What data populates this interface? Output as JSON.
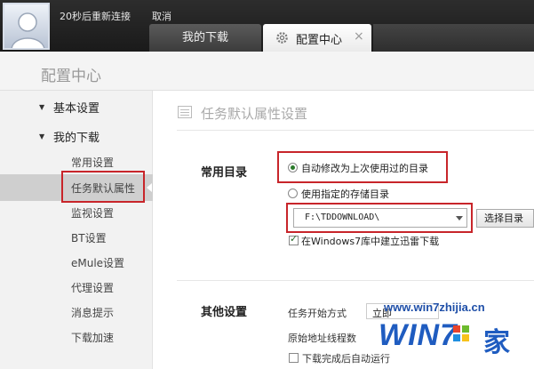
{
  "header": {
    "reconnect_text": "20秒后重新连接",
    "cancel_label": "取消",
    "tabs": [
      {
        "label": "我的下载"
      },
      {
        "label": "配置中心",
        "close": "×"
      }
    ]
  },
  "config_title": "配置中心",
  "sidebar": {
    "groups": [
      {
        "label": "基本设置",
        "arrow": "▼"
      },
      {
        "label": "我的下载",
        "arrow": "▼"
      }
    ],
    "items": [
      {
        "label": "常用设置"
      },
      {
        "label": "任务默认属性"
      },
      {
        "label": "监视设置"
      },
      {
        "label": "BT设置"
      },
      {
        "label": "eMule设置"
      },
      {
        "label": "代理设置"
      },
      {
        "label": "消息提示"
      },
      {
        "label": "下载加速"
      }
    ],
    "selected_index": 1
  },
  "main": {
    "section_title": "任务默认属性设置",
    "common_dir": {
      "label": "常用目录",
      "option_auto": "自动修改为上次使用过的目录",
      "option_specified": "使用指定的存储目录",
      "selected": "auto",
      "path_value": "F:\\TDDOWNLOAD\\",
      "choose_button": "选择目录",
      "win7_library_label": "在Windows7库中建立迅雷下载",
      "win7_library_checked": true
    },
    "other": {
      "label": "其他设置",
      "task_start_label": "任务开始方式",
      "task_start_value": "立即",
      "threads_label": "原始地址线程数",
      "run_after_label": "下载完成后自动运行",
      "run_after_checked": false
    }
  },
  "watermark": {
    "url": "www.win7zhijia.cn",
    "logo_text": "WIN7",
    "logo_char": "家"
  },
  "colors": {
    "highlight_red": "#c8252a",
    "watermark_blue": "#1f5cc0"
  }
}
